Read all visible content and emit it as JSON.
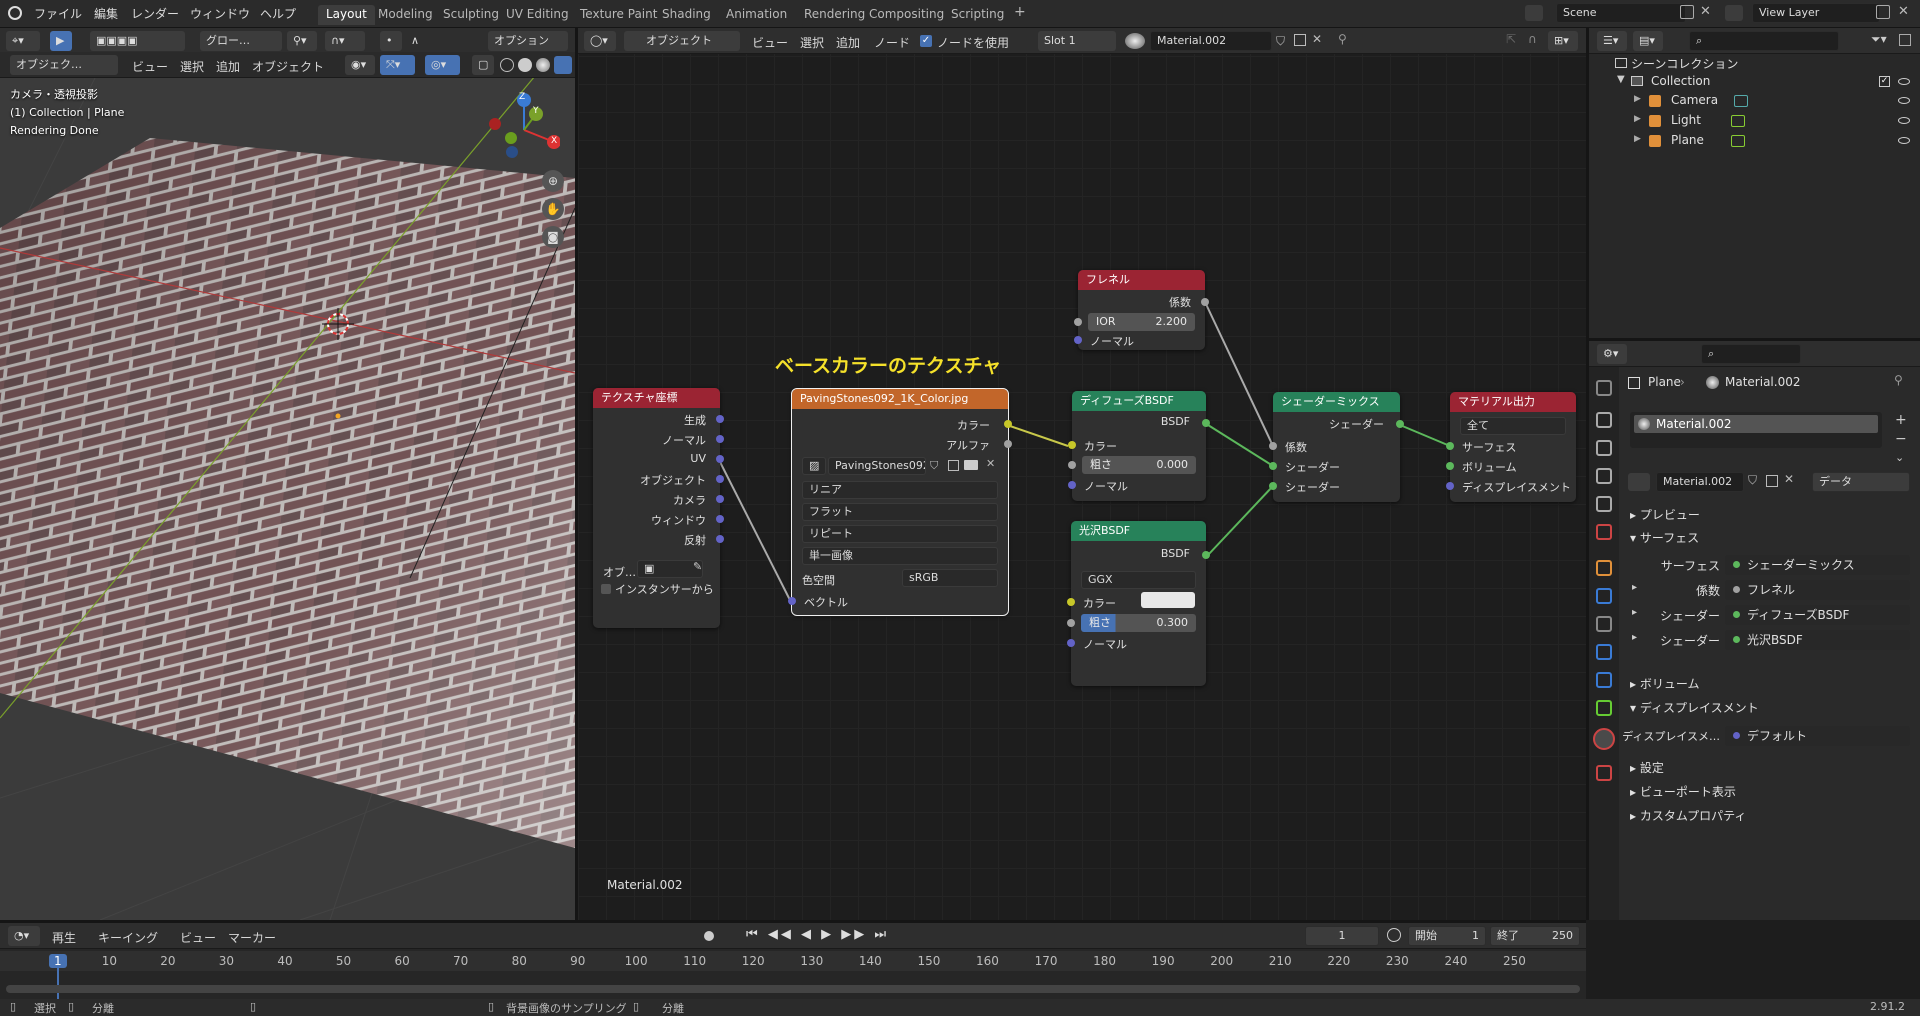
{
  "menu": {
    "file": "ファイル",
    "edit": "編集",
    "render": "レンダー",
    "window": "ウィンドウ",
    "help": "ヘルプ"
  },
  "workspaces": [
    "Layout",
    "Modeling",
    "Sculpting",
    "UV Editing",
    "Texture Paint",
    "Shading",
    "Animation",
    "Rendering",
    "Compositing",
    "Scripting"
  ],
  "scene": {
    "name": "Scene",
    "view_layer": "View Layer"
  },
  "viewport": {
    "header": {
      "mode": "オブジェク…",
      "view": "ビュー",
      "select": "選択",
      "add": "追加",
      "object": "オブジェクト",
      "transform": "グロー…",
      "options": "オプション"
    },
    "info": {
      "line1": "カメラ・透視投影",
      "line2": "(1) Collection | Plane",
      "line3": "Rendering Done"
    },
    "gizmo": {
      "x": "X",
      "y": "Y",
      "z": "Z"
    }
  },
  "node_editor": {
    "header": {
      "mode": "オブジェクト",
      "view": "ビュー",
      "select": "選択",
      "add": "追加",
      "node": "ノード",
      "use_nodes": "ノードを使用",
      "slot": "Slot 1",
      "material": "Material.002"
    },
    "annotation": "ベースカラーのテクスチャ",
    "footer_material": "Material.002",
    "nodes": {
      "texcoord": {
        "title": "テクスチャ座標",
        "outputs": [
          "生成",
          "ノーマル",
          "UV",
          "オブジェクト",
          "カメラ",
          "ウィンドウ",
          "反射"
        ],
        "object_label": "オブ…",
        "from_instancer": "インスタンサーから"
      },
      "image": {
        "title": "PavingStones092_1K_Color.jpg",
        "out_color": "カラー",
        "out_alpha": "アルファ",
        "image_name": "PavingStones092...",
        "interp": "リニア",
        "proj": "フラット",
        "ext": "リピート",
        "source": "単一画像",
        "colorspace_label": "色空間",
        "colorspace": "sRGB",
        "in_vector": "ベクトル"
      },
      "fresnel": {
        "title": "フレネル",
        "out_fac": "係数",
        "ior_label": "IOR",
        "ior": "2.200",
        "normal": "ノーマル"
      },
      "diffuse": {
        "title": "ディフューズBSDF",
        "out": "BSDF",
        "color": "カラー",
        "rough_label": "粗さ",
        "rough": "0.000",
        "normal": "ノーマル"
      },
      "glossy": {
        "title": "光沢BSDF",
        "out": "BSDF",
        "dist": "GGX",
        "color": "カラー",
        "rough_label": "粗さ",
        "rough": "0.300",
        "normal": "ノーマル"
      },
      "mix": {
        "title": "シェーダーミックス",
        "out": "シェーダー",
        "fac": "係数",
        "shader1": "シェーダー",
        "shader2": "シェーダー"
      },
      "output": {
        "title": "マテリアル出力",
        "target": "全て",
        "surface": "サーフェス",
        "volume": "ボリューム",
        "displacement": "ディスプレイスメント"
      }
    }
  },
  "outliner": {
    "root": "シーンコレクション",
    "collection": "Collection",
    "items": [
      "Camera",
      "Light",
      "Plane"
    ]
  },
  "properties": {
    "object": "Plane",
    "material": "Material.002",
    "slot": "Material.002",
    "mat_field": "Material.002",
    "data_link": "データ",
    "sections": {
      "preview": "プレビュー",
      "surface": "サーフェス",
      "volume": "ボリューム",
      "displacement": "ディスプレイスメント",
      "settings": "設定",
      "viewport_display": "ビューポート表示",
      "custom_props": "カスタムプロパティ"
    },
    "surface_rows": [
      {
        "label": "サーフェス",
        "value": "シェーダーミックス"
      },
      {
        "label": "係数",
        "value": "フレネル"
      },
      {
        "label": "シェーダー",
        "value": "ディフューズBSDF"
      },
      {
        "label": "シェーダー",
        "value": "光沢BSDF"
      }
    ],
    "disp_row": {
      "label": "ディスプレイスメ…",
      "value": "デフォルト"
    }
  },
  "timeline": {
    "play": "再生",
    "keying": "キーイング",
    "view": "ビュー",
    "marker": "マーカー",
    "current_frame": "1",
    "start_label": "開始",
    "start": "1",
    "end_label": "終了",
    "end": "250",
    "ticks": [
      "1",
      "10",
      "20",
      "30",
      "40",
      "50",
      "60",
      "70",
      "80",
      "90",
      "100",
      "110",
      "120",
      "130",
      "140",
      "150",
      "160",
      "170",
      "180",
      "190",
      "200",
      "210",
      "220",
      "230",
      "240",
      "250"
    ]
  },
  "statusbar": {
    "select": "選択",
    "split": "分離",
    "sample": "背景画像のサンプリング",
    "split2": "分離",
    "version": "2.91.2"
  },
  "colors": {
    "accent": "#4772b3",
    "texture_node": "#c2662a",
    "shader_node": "#27825a",
    "output_node": "#9b2433",
    "input_node": "#9b2433"
  }
}
